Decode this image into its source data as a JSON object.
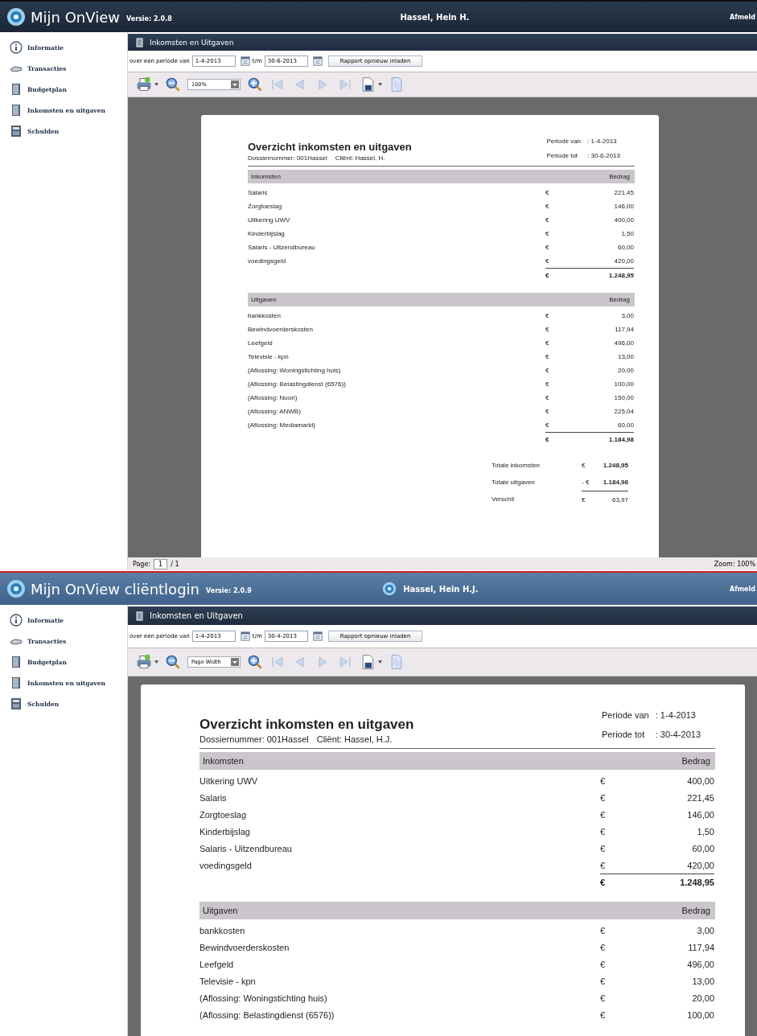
{
  "screens": [
    {
      "header": {
        "app_title": "Mijn OnView",
        "version": "Versie: 2.0.8",
        "user": "Hassel, Hein H.",
        "logout": "Afmeld"
      },
      "sidebar": [
        {
          "label": "Informatie"
        },
        {
          "label": "Transacties"
        },
        {
          "label": "Budgetplan"
        },
        {
          "label": "Inkomsten en uitgaven"
        },
        {
          "label": "Schulden"
        }
      ],
      "panel_title": "Inkomsten en Uitgaven",
      "period": {
        "label": "over een periode van",
        "from": "1-4-2013",
        "to_label": "t/m",
        "to": "30-6-2013",
        "reload_button": "Rapport opnieuw inladen"
      },
      "toolbar": {
        "zoom": "100%"
      },
      "report": {
        "title": "Overzicht inkomsten en uitgaven",
        "dossier": "Dossiernummer: 001Hassel",
        "client": "Cliënt: Hassel, H.",
        "period_from_label": "Periode van",
        "period_from": ": 1-4-2013",
        "period_to_label": "Periode tot",
        "period_to": ": 30-6-2013",
        "sections": [
          {
            "heading": "Inkomsten",
            "amount_heading": "Bedrag",
            "rows": [
              {
                "label": "Salaris",
                "currency": "€",
                "amount": "221,45"
              },
              {
                "label": "Zorgtoeslag",
                "currency": "€",
                "amount": "146,00"
              },
              {
                "label": "Uitkering UWV",
                "currency": "€",
                "amount": "400,00"
              },
              {
                "label": "Kinderbijslag",
                "currency": "€",
                "amount": "1,50"
              },
              {
                "label": "Salaris - Uitzendbureau",
                "currency": "€",
                "amount": "60,00"
              },
              {
                "label": "voedingsgeld",
                "currency": "€",
                "amount": "420,00"
              }
            ],
            "total": {
              "currency": "€",
              "amount": "1.248,95"
            }
          },
          {
            "heading": "Uitgaven",
            "amount_heading": "Bedrag",
            "rows": [
              {
                "label": "bankkosten",
                "currency": "€",
                "amount": "3,00"
              },
              {
                "label": "Bewindvoerderskosten",
                "currency": "€",
                "amount": "117,94"
              },
              {
                "label": "Leefgeld",
                "currency": "€",
                "amount": "496,00"
              },
              {
                "label": "Televisie - kpn",
                "currency": "€",
                "amount": "13,00"
              },
              {
                "label": "(Aflossing: Woningstichting huis)",
                "currency": "€",
                "amount": "20,00"
              },
              {
                "label": "(Aflossing: Belastingdienst (6576))",
                "currency": "€",
                "amount": "100,00"
              },
              {
                "label": "(Aflossing: Nuon)",
                "currency": "€",
                "amount": "150,00"
              },
              {
                "label": "(Aflossing: ANWB)",
                "currency": "€",
                "amount": "225,04"
              },
              {
                "label": "(Aflossing: Mediamarkt)",
                "currency": "€",
                "amount": "60,00"
              }
            ],
            "total": {
              "currency": "€",
              "amount": "1.184,98"
            }
          }
        ],
        "summary": [
          {
            "label": "Totale inkomsten",
            "currency": "€",
            "amount": "1.248,95"
          },
          {
            "label": "Totale uitgaven",
            "currency": "- €",
            "amount": "1.184,98"
          },
          {
            "label": "Verschil",
            "currency": "€",
            "amount": "63,97"
          }
        ]
      },
      "status_bar": {
        "page_label": "Page:",
        "page": "1",
        "of": "/ 1",
        "zoom": "Zoom: 100%"
      }
    },
    {
      "header": {
        "app_title": "Mijn OnView cliëntlogin",
        "version": "Versie: 2.0.9",
        "user": "Hassel, Hein H.J.",
        "logout": "Afmeld"
      },
      "sidebar": [
        {
          "label": "Informatie"
        },
        {
          "label": "Transacties"
        },
        {
          "label": "Budgetplan"
        },
        {
          "label": "Inkomsten en uitgaven"
        },
        {
          "label": "Schulden"
        }
      ],
      "panel_title": "Inkomsten en Uitgaven",
      "period": {
        "label": "over een periode van",
        "from": "1-4-2013",
        "to_label": "t/m",
        "to": "30-4-2013",
        "reload_button": "Rapport opnieuw inladen"
      },
      "toolbar": {
        "zoom": "Page Width"
      },
      "report": {
        "title": "Overzicht inkomsten en uitgaven",
        "dossier": "Dossiernummer: 001Hassel",
        "client": "Cliënt: Hassel, H.J.",
        "period_from_label": "Periode van",
        "period_from": ": 1-4-2013",
        "period_to_label": "Periode tot",
        "period_to": ": 30-4-2013",
        "sections": [
          {
            "heading": "Inkomsten",
            "amount_heading": "Bedrag",
            "rows": [
              {
                "label": "Uitkering UWV",
                "currency": "€",
                "amount": "400,00"
              },
              {
                "label": "Salaris",
                "currency": "€",
                "amount": "221,45"
              },
              {
                "label": "Zorgtoeslag",
                "currency": "€",
                "amount": "146,00"
              },
              {
                "label": "Kinderbijslag",
                "currency": "€",
                "amount": "1,50"
              },
              {
                "label": "Salaris - Uitzendbureau",
                "currency": "€",
                "amount": "60,00"
              },
              {
                "label": "voedingsgeld",
                "currency": "€",
                "amount": "420,00"
              }
            ],
            "total": {
              "currency": "€",
              "amount": "1.248,95"
            }
          },
          {
            "heading": "Uitgaven",
            "amount_heading": "Bedrag",
            "rows": [
              {
                "label": "bankkosten",
                "currency": "€",
                "amount": "3,00"
              },
              {
                "label": "Bewindvoerderskosten",
                "currency": "€",
                "amount": "117,94"
              },
              {
                "label": "Leefgeld",
                "currency": "€",
                "amount": "496,00"
              },
              {
                "label": "Televisie - kpn",
                "currency": "€",
                "amount": "13,00"
              },
              {
                "label": "(Aflossing: Woningstichting huis)",
                "currency": "€",
                "amount": "20,00"
              },
              {
                "label": "(Aflossing: Belastingdienst (6576))",
                "currency": "€",
                "amount": "100,00"
              }
            ]
          }
        ]
      }
    }
  ]
}
